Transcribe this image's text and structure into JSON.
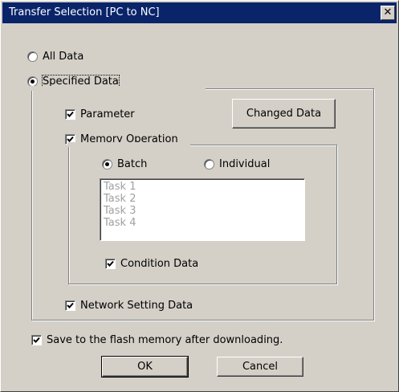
{
  "window": {
    "title": "Transfer Selection [PC to NC]",
    "close_glyph": "✕"
  },
  "options": {
    "all_data_label": "All Data",
    "all_data_selected": false,
    "specified_data_label": "Specified Data",
    "specified_data_selected": true
  },
  "specified": {
    "parameter_label": "Parameter",
    "parameter_checked": true,
    "changed_data_label": "Changed Data",
    "memory_operation_label": "Memory Operation",
    "memory_operation_checked": true,
    "batch_label": "Batch",
    "batch_selected": true,
    "individual_label": "Individual",
    "individual_selected": false,
    "tasks": [
      "Task 1",
      "Task 2",
      "Task 3",
      "Task 4"
    ],
    "condition_data_label": "Condition Data",
    "condition_data_checked": true,
    "network_setting_label": "Network Setting Data",
    "network_setting_checked": true
  },
  "save_flash_label": "Save to the flash memory after downloading.",
  "save_flash_checked": true,
  "buttons": {
    "ok_label": "OK",
    "cancel_label": "Cancel"
  },
  "colors": {
    "titlebar": "#0a246a",
    "face": "#d4d0c8",
    "disabled_text": "#a0a0a0"
  }
}
